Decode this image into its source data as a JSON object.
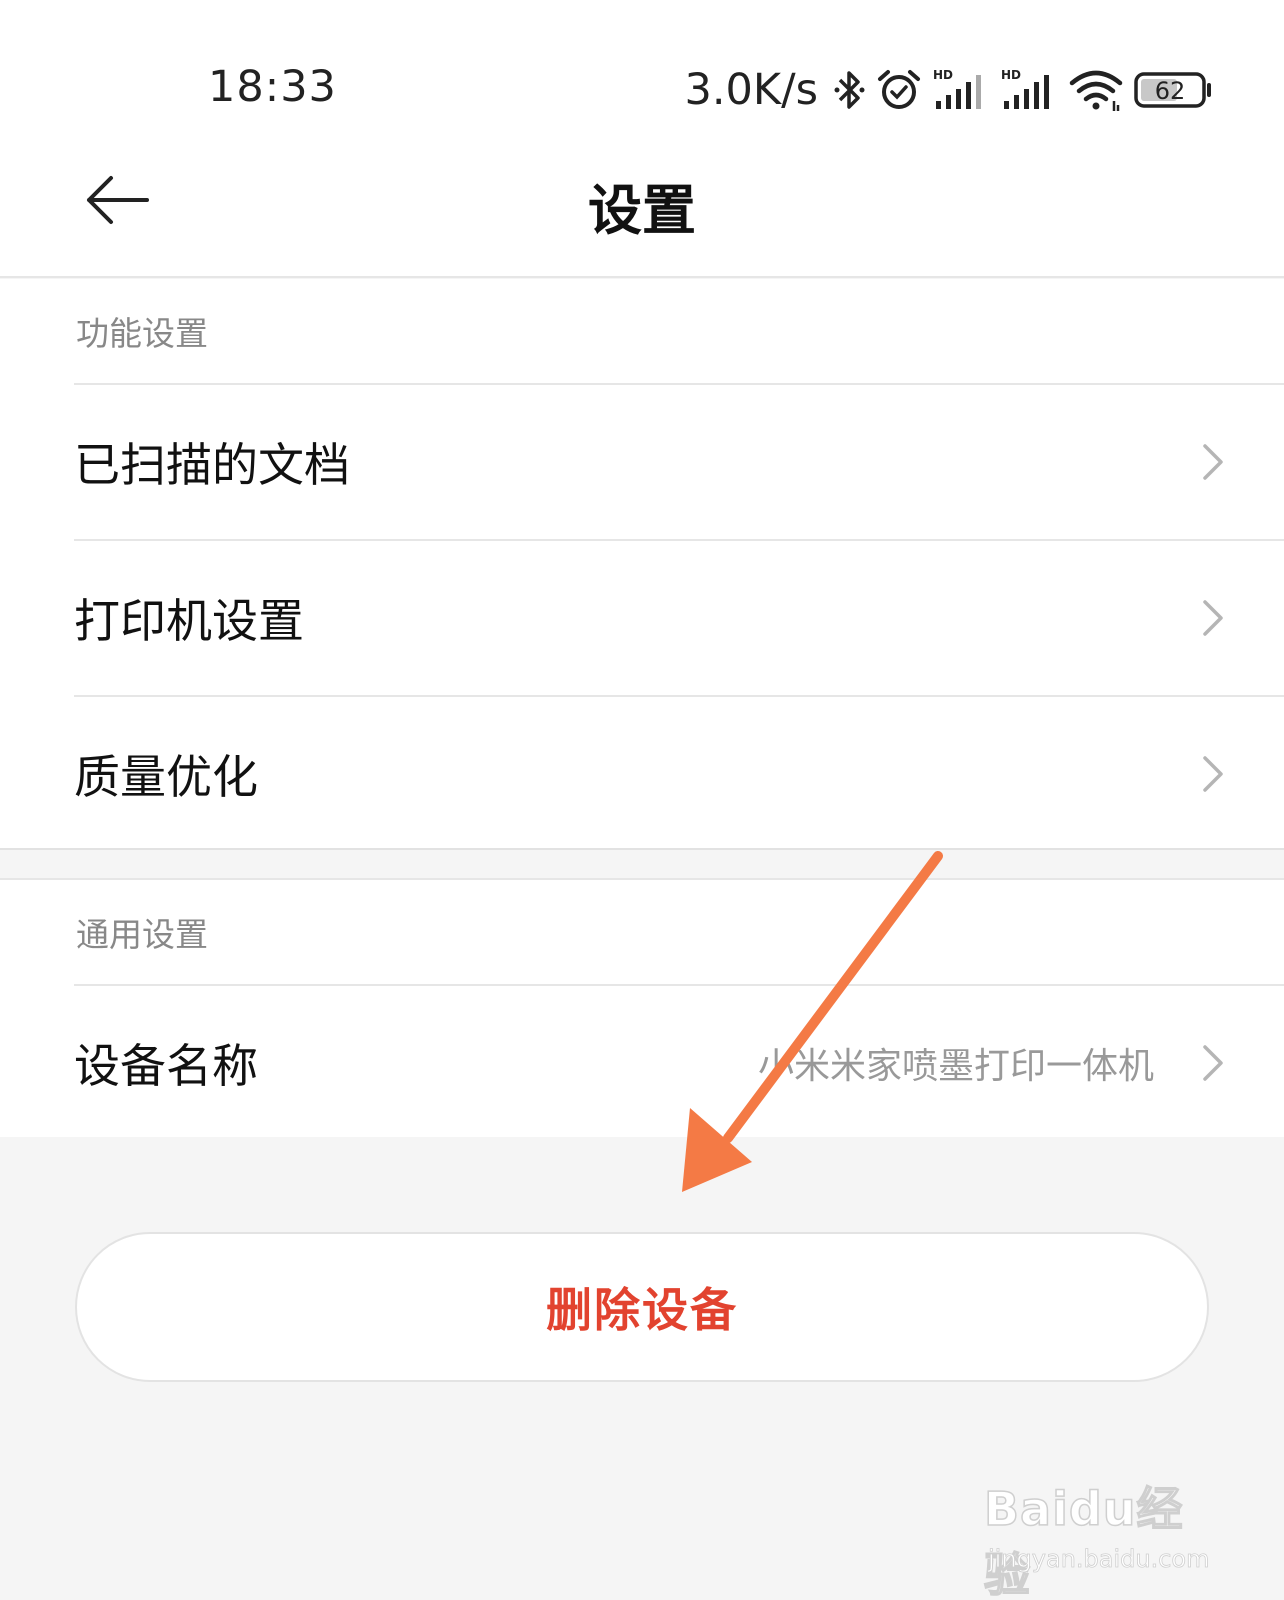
{
  "status_bar": {
    "time": "18:33",
    "net_speed": "3.0K/s",
    "icons": [
      "bluetooth-icon",
      "alarm-icon",
      "hd-signal-icon",
      "hd-signal-icon",
      "wifi-icon",
      "battery-icon"
    ],
    "signal_badge_1": "HD",
    "signal_badge_2": "HD",
    "battery_level": "62"
  },
  "header": {
    "title": "设置",
    "back_icon": "back-arrow-icon"
  },
  "sections": {
    "function": {
      "header": "功能设置",
      "items": [
        {
          "label": "已扫描的文档"
        },
        {
          "label": "打印机设置"
        },
        {
          "label": "质量优化"
        }
      ]
    },
    "general": {
      "header": "通用设置",
      "items": [
        {
          "label": "设备名称",
          "value": "小米米家喷墨打印一体机"
        }
      ]
    }
  },
  "actions": {
    "delete_label": "删除设备"
  },
  "watermark": {
    "brand": "Baidu经验",
    "url": "jingyan.baidu.com"
  },
  "colors": {
    "delete_text": "#e2432f",
    "arrow": "#f47a45",
    "background": "#f5f5f5"
  }
}
